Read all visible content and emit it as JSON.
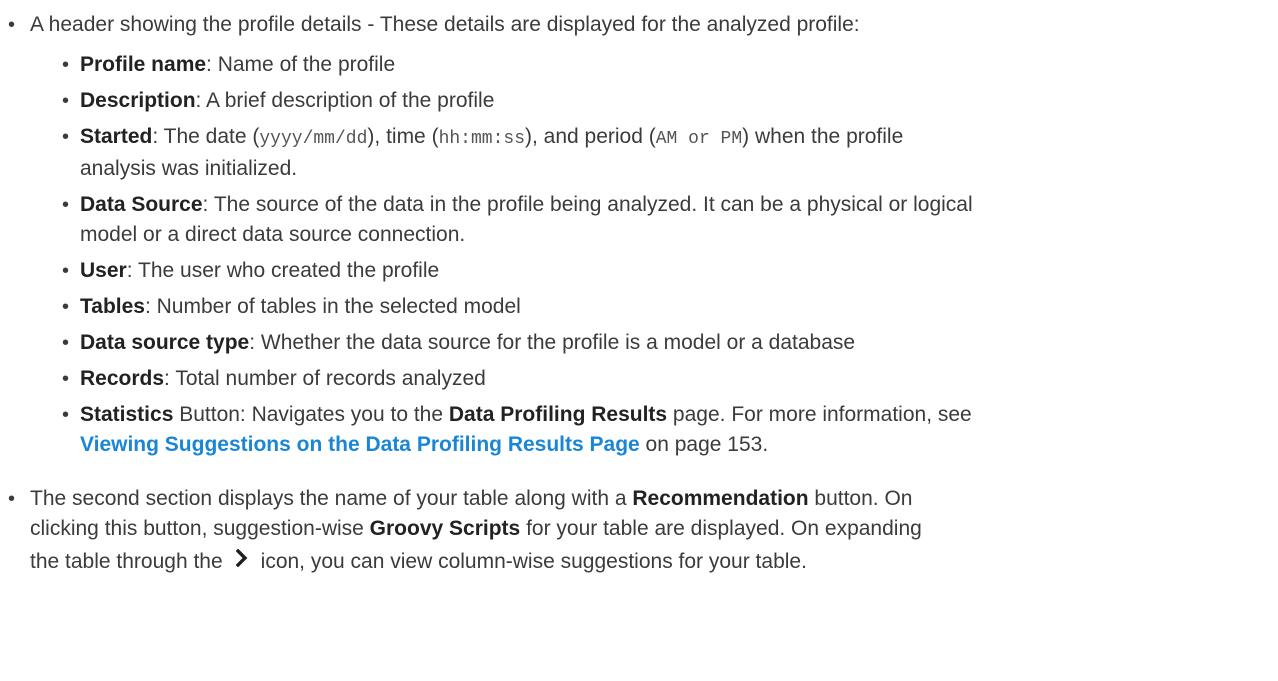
{
  "header_item": {
    "text": "A header showing the profile details - These details are displayed for the analyzed profile:",
    "details": [
      {
        "label": "Profile name",
        "desc": ": Name of the profile"
      },
      {
        "label": "Description",
        "desc": ": A brief description of the profile"
      },
      {
        "label": "Started",
        "parts": [
          ": The date (",
          "yyyy/mm/dd",
          "), time (",
          "hh:mm:ss",
          "), and period (",
          "AM or PM",
          ") when the profile"
        ],
        "cont": "analysis was initialized."
      },
      {
        "label": "Data Source",
        "desc": ": The source of the data in the profile being analyzed. It can be a physical or logical",
        "cont": "model or a direct data source connection."
      },
      {
        "label": "User",
        "desc": ": The user who created the profile"
      },
      {
        "label": "Tables",
        "desc": ": Number of tables in the selected model"
      },
      {
        "label": "Data source type",
        "desc": ": Whether the data source for the profile is a model or a database"
      },
      {
        "label": "Records",
        "desc": ": Total number of records analyzed"
      },
      {
        "label": "Statistics",
        "desc_a": " Button: Navigates you to the ",
        "bold_b": "Data Profiling Results",
        "desc_c": " page. For more information, see",
        "link": "Viewing Suggestions on the Data Profiling Results Page",
        "after_link": " on page 153."
      }
    ]
  },
  "second_item": {
    "line1_a": "The second section displays the name of your table along with a ",
    "line1_b": "Recommendation",
    "line1_c": " button. On",
    "line2_a": "clicking this button, suggestion-wise ",
    "line2_b": "Groovy Scripts",
    "line2_c": " for your table are displayed. On expanding",
    "line3_a": "the table through the",
    "line3_b": "icon, you can view column-wise suggestions for your table."
  },
  "icons": {
    "expand": "chevron-right-icon"
  },
  "colors": {
    "text": "#3b3b3b",
    "link": "#1a86d6"
  }
}
